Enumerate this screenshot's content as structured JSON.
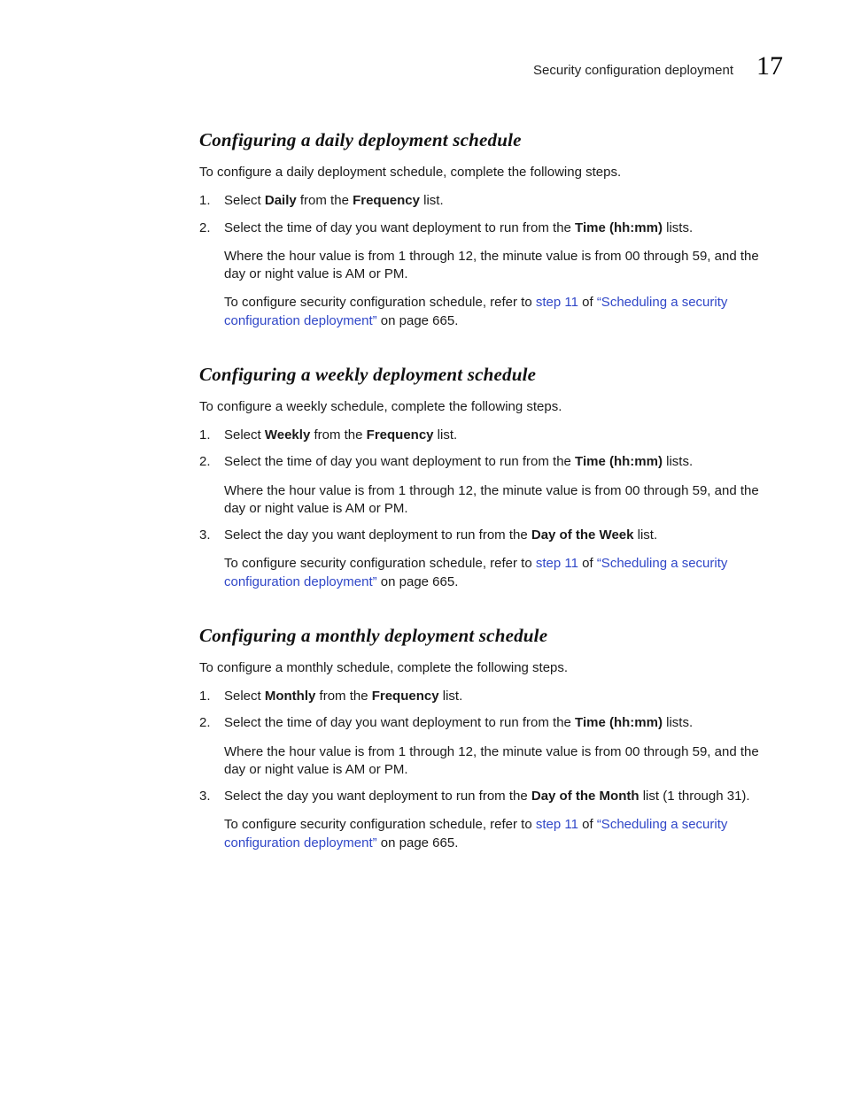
{
  "header": {
    "running_title": "Security configuration deployment",
    "chapter_number": "17"
  },
  "sections": {
    "daily": {
      "heading": "Configuring a daily deployment schedule",
      "intro": "To configure a daily deployment schedule, complete the following steps.",
      "step1_pre": "Select ",
      "step1_b1": "Daily",
      "step1_mid": " from the ",
      "step1_b2": "Frequency",
      "step1_post": " list.",
      "step2_pre": "Select the time of day you want deployment to run from the ",
      "step2_b1": "Time (hh:mm)",
      "step2_post": " lists.",
      "step2_sub1": "Where the hour value is from 1 through 12, the minute value is from 00 through 59, and the day or night value is AM or PM.",
      "step2_sub2_pre": "To configure security configuration schedule, refer to ",
      "step2_sub2_link1": "step 11",
      "step2_sub2_mid": " of ",
      "step2_sub2_link2": "“Scheduling a security configuration deployment”",
      "step2_sub2_post": " on page 665."
    },
    "weekly": {
      "heading": "Configuring a weekly deployment schedule",
      "intro": "To configure a weekly schedule, complete the following steps.",
      "step1_pre": "Select ",
      "step1_b1": "Weekly",
      "step1_mid": " from the ",
      "step1_b2": "Frequency",
      "step1_post": " list.",
      "step2_pre": "Select the time of day you want deployment to run from the ",
      "step2_b1": "Time (hh:mm)",
      "step2_post": " lists.",
      "step2_sub1": "Where the hour value is from 1 through 12, the minute value is from 00 through 59, and the day or night value is AM or PM.",
      "step3_pre": "Select the day you want deployment to run from the ",
      "step3_b1": "Day of the Week",
      "step3_post": " list.",
      "step3_sub2_pre": "To configure security configuration schedule, refer to ",
      "step3_sub2_link1": "step 11",
      "step3_sub2_mid": " of ",
      "step3_sub2_link2": "“Scheduling a security configuration deployment”",
      "step3_sub2_post": " on page 665."
    },
    "monthly": {
      "heading": "Configuring a monthly deployment schedule",
      "intro": "To configure a monthly schedule, complete the following steps.",
      "step1_pre": "Select ",
      "step1_b1": "Monthly",
      "step1_mid": " from the ",
      "step1_b2": "Frequency",
      "step1_post": " list.",
      "step2_pre": "Select the time of day you want deployment to run from the ",
      "step2_b1": "Time (hh:mm)",
      "step2_post": " lists.",
      "step2_sub1": "Where the hour value is from 1 through 12, the minute value is from 00 through 59, and the day or night value is AM or PM.",
      "step3_pre": "Select the day you want deployment to run from the ",
      "step3_b1": "Day of the Month",
      "step3_post": " list (1 through 31).",
      "step3_sub2_pre": "To configure security configuration schedule, refer to ",
      "step3_sub2_link1": "step 11",
      "step3_sub2_mid": " of ",
      "step3_sub2_link2": "“Scheduling a security configuration deployment”",
      "step3_sub2_post": " on page 665."
    }
  }
}
